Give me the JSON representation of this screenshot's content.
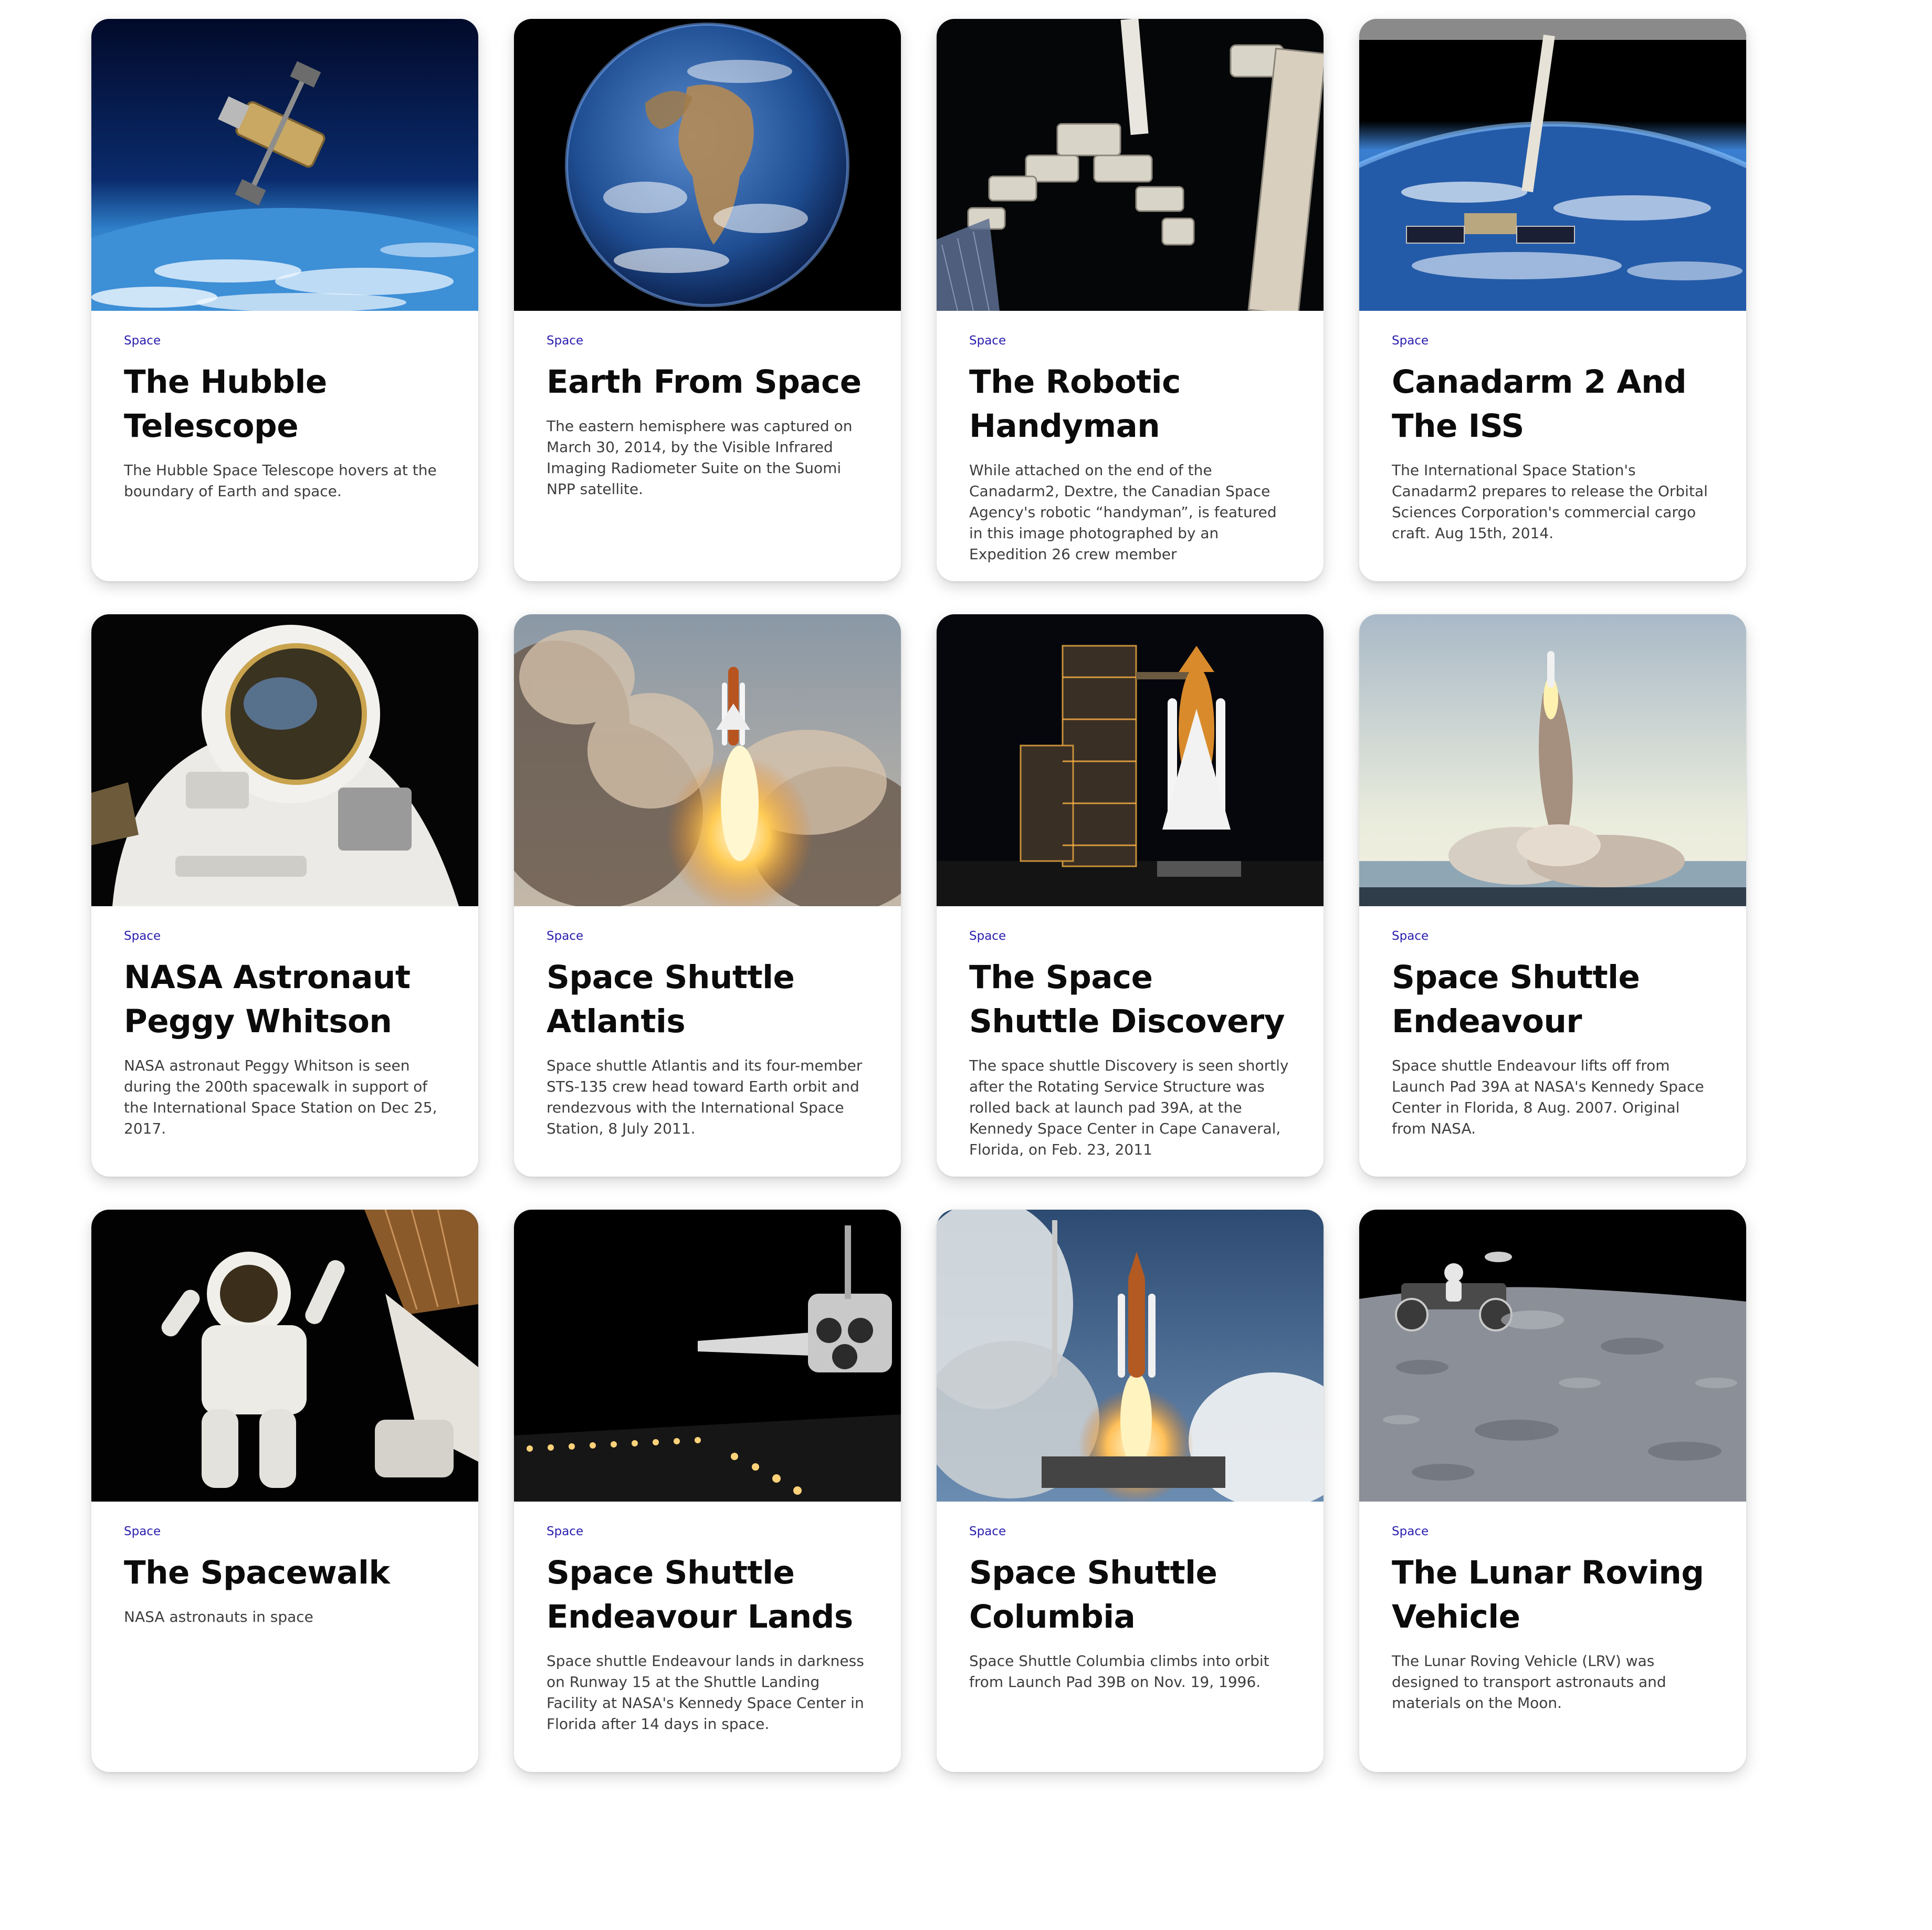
{
  "cards": [
    {
      "category": "Space",
      "title": "The Hubble Telescope",
      "description": "The Hubble Space Telescope hovers at the boundary of Earth and space.",
      "image": "hubble-over-earth"
    },
    {
      "category": "Space",
      "title": "Earth From Space",
      "description": "The eastern hemisphere was captured on March 30, 2014, by the Visible Infrared Imaging Radiometer Suite on the Suomi NPP satellite.",
      "image": "earth-globe"
    },
    {
      "category": "Space",
      "title": "The Robotic Handyman",
      "description": "While attached on the end of the Canadarm2, Dextre, the Canadian Space Agency's robotic “handyman”, is featured in this image photographed by an Expedition 26 crew member",
      "image": "dextre-robot-arm"
    },
    {
      "category": "Space",
      "title": "Canadarm 2 And The ISS",
      "description": "The International Space Station's Canadarm2 prepares to release the Orbital Sciences Corporation's commercial cargo craft. Aug 15th, 2014.",
      "image": "canadarm-over-earth"
    },
    {
      "category": "Space",
      "title": "NASA Astronaut Peggy Whitson",
      "description": "NASA astronaut Peggy Whitson is seen during the 200th spacewalk in support of the International Space Station on Dec 25, 2017.",
      "image": "astronaut-helmet"
    },
    {
      "category": "Space",
      "title": "Space Shuttle Atlantis",
      "description": "Space shuttle Atlantis and its four-member STS-135 crew head toward Earth orbit and rendezvous with the International Space Station, 8 July 2011.",
      "image": "shuttle-launch-clouds"
    },
    {
      "category": "Space",
      "title": "The Space Shuttle Discovery",
      "description": "The space shuttle Discovery is seen shortly after the Rotating Service Structure was rolled back at launch pad 39A, at the Kennedy Space Center in Cape Canaveral, Florida, on Feb. 23, 2011",
      "image": "shuttle-on-pad-night"
    },
    {
      "category": "Space",
      "title": "Space Shuttle Endeavour",
      "description": "Space shuttle Endeavour lifts off from Launch Pad 39A at NASA's Kennedy Space Center in Florida, 8 Aug. 2007. Original from NASA.",
      "image": "shuttle-liftoff-distant"
    },
    {
      "category": "Space",
      "title": "The Spacewalk",
      "description": "NASA astronauts in space",
      "image": "astronaut-spacewalk"
    },
    {
      "category": "Space",
      "title": "Space Shuttle Endeavour Lands",
      "description": "Space shuttle Endeavour lands in darkness on Runway 15 at the Shuttle Landing Facility at NASA's Kennedy Space Center in Florida after 14 days in space.",
      "image": "shuttle-landing-night"
    },
    {
      "category": "Space",
      "title": "Space Shuttle Columbia",
      "description": "Space Shuttle Columbia climbs into orbit from Launch Pad 39B on Nov. 19, 1996.",
      "image": "shuttle-launch-day"
    },
    {
      "category": "Space",
      "title": "The Lunar Roving Vehicle",
      "description": "The Lunar Roving Vehicle (LRV) was designed to transport astronauts and materials on the Moon.",
      "image": "lunar-rover"
    }
  ]
}
